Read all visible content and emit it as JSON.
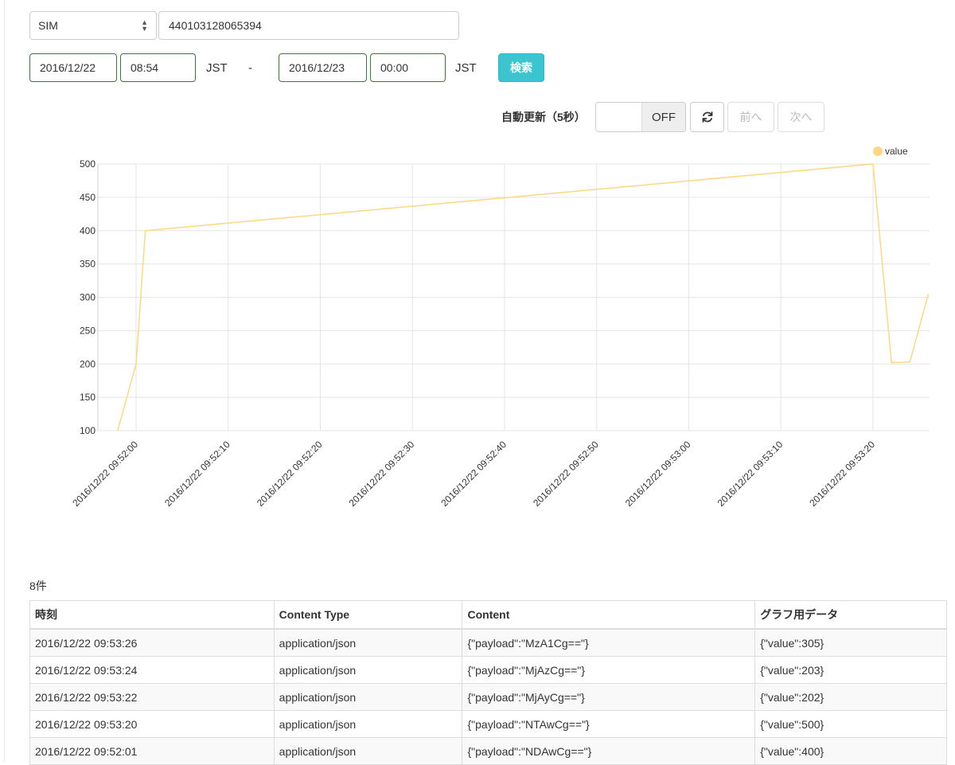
{
  "filter": {
    "type_select": "SIM",
    "id_value": "440103128065394",
    "from_date": "2016/12/22",
    "from_time": "08:54",
    "from_tz": "JST",
    "separator": "-",
    "to_date": "2016/12/23",
    "to_time": "00:00",
    "to_tz": "JST",
    "search_label": "検索"
  },
  "controls": {
    "auto_refresh_label": "自動更新（5秒）",
    "toggle_state": "OFF",
    "prev_label": "前へ",
    "next_label": "次へ",
    "refresh_icon": "refresh-icon"
  },
  "chart_data": {
    "type": "line",
    "series": [
      {
        "name": "value",
        "color": "#fdd782",
        "points": [
          {
            "x": "2016/12/22 09:51:58",
            "y": 100
          },
          {
            "x": "2016/12/22 09:52:00",
            "y": 200
          },
          {
            "x": "2016/12/22 09:52:01",
            "y": 400
          },
          {
            "x": "2016/12/22 09:53:20",
            "y": 500
          },
          {
            "x": "2016/12/22 09:53:22",
            "y": 202
          },
          {
            "x": "2016/12/22 09:53:24",
            "y": 203
          },
          {
            "x": "2016/12/22 09:53:26",
            "y": 305
          }
        ]
      }
    ],
    "x_ticks": [
      "2016/12/22 09:52:00",
      "2016/12/22 09:52:10",
      "2016/12/22 09:52:20",
      "2016/12/22 09:52:30",
      "2016/12/22 09:52:40",
      "2016/12/22 09:52:50",
      "2016/12/22 09:53:00",
      "2016/12/22 09:53:10",
      "2016/12/22 09:53:20"
    ],
    "y_ticks": [
      100,
      150,
      200,
      250,
      300,
      350,
      400,
      450,
      500
    ],
    "ylim": [
      100,
      500
    ],
    "legend_position": "top-right",
    "grid": true
  },
  "table": {
    "count_label": "8件",
    "headers": [
      "時刻",
      "Content Type",
      "Content",
      "グラフ用データ"
    ],
    "rows": [
      [
        "2016/12/22 09:53:26",
        "application/json",
        "{\"payload\":\"MzA1Cg==\"}",
        "{\"value\":305}"
      ],
      [
        "2016/12/22 09:53:24",
        "application/json",
        "{\"payload\":\"MjAzCg==\"}",
        "{\"value\":203}"
      ],
      [
        "2016/12/22 09:53:22",
        "application/json",
        "{\"payload\":\"MjAyCg==\"}",
        "{\"value\":202}"
      ],
      [
        "2016/12/22 09:53:20",
        "application/json",
        "{\"payload\":\"NTAwCg==\"}",
        "{\"value\":500}"
      ],
      [
        "2016/12/22 09:52:01",
        "application/json",
        "{\"payload\":\"NDAwCg==\"}",
        "{\"value\":400}"
      ]
    ]
  }
}
